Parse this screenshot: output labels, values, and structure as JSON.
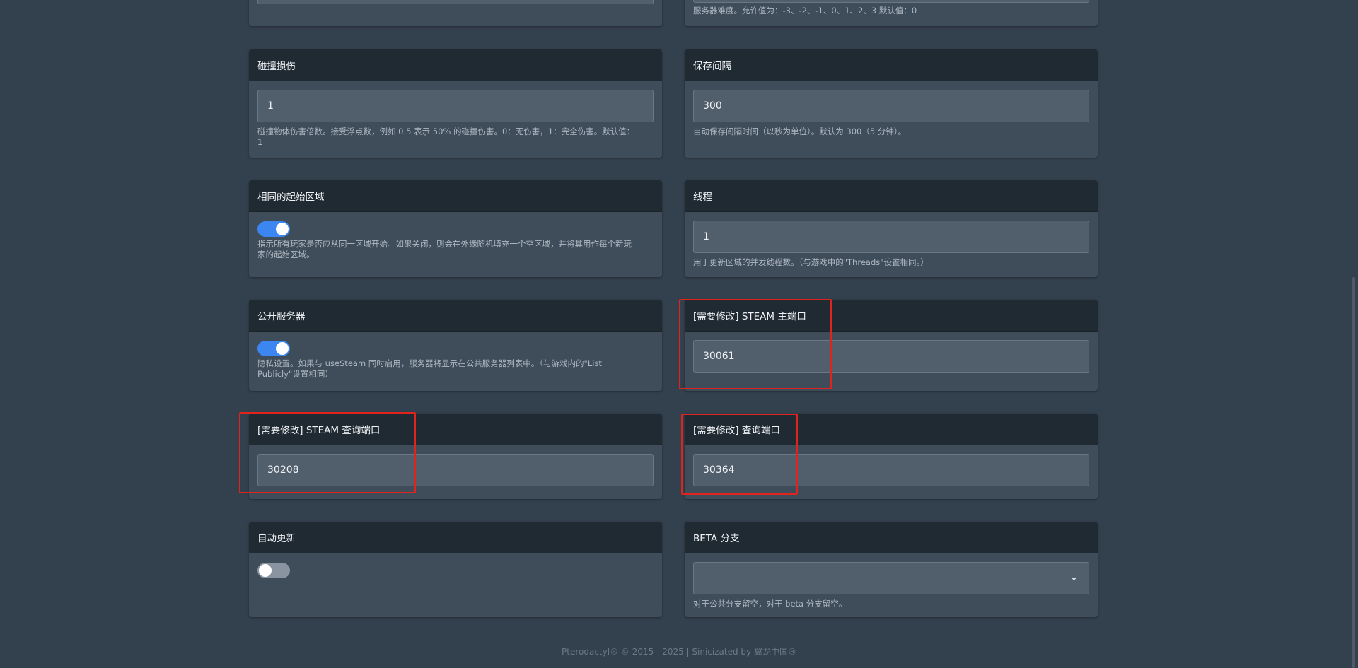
{
  "top": {
    "right_desc": "服务器难度。允许值为：-3、-2、-1、0、1、2、3 默认值：0"
  },
  "cards": {
    "collision": {
      "title": "碰撞损伤",
      "value": "1",
      "desc": "碰撞物体伤害倍数。接受浮点数，例如 0.5 表示 50% 的碰撞伤害。0：无伤害，1：完全伤害。默认值：1"
    },
    "save_interval": {
      "title": "保存间隔",
      "value": "300",
      "desc": "自动保存间隔时间（以秒为单位）。默认为 300（5 分钟）。"
    },
    "same_start": {
      "title": "相同的起始区域",
      "enabled": true,
      "desc": "指示所有玩家是否应从同一区域开始。如果关闭，则会在外缘随机填充一个空区域，并将其用作每个新玩家的起始区域。"
    },
    "threads": {
      "title": "线程",
      "value": "1",
      "desc": "用于更新区域的并发线程数。（与游戏中的\"Threads\"设置相同。）"
    },
    "public_server": {
      "title": "公开服务器",
      "enabled": true,
      "desc": "隐私设置。如果与 useSteam 同时启用，服务器将显示在公共服务器列表中。（与游戏内的\"List Publicly\"设置相同）"
    },
    "steam_main_port": {
      "title": "[需要修改] STEAM 主端口",
      "value": "30061"
    },
    "steam_query_port": {
      "title": "[需要修改] STEAM 查询端口",
      "value": "30208"
    },
    "query_port": {
      "title": "[需要修改] 查询端口",
      "value": "30364"
    },
    "auto_update": {
      "title": "自动更新",
      "enabled": false
    },
    "beta_branch": {
      "title": "BETA 分支",
      "value": "",
      "desc": "对于公共分支留空，对于 beta 分支留空。"
    }
  },
  "footer": {
    "text": "Pterodactyl® © 2015 - 2025 | Sinicizated by 翼龙中国®"
  },
  "colors": {
    "background": "#33404d",
    "card": "#3f4c59",
    "card_header": "#202a33",
    "toggle_on": "#3b86f0",
    "highlight": "#e0231c"
  }
}
